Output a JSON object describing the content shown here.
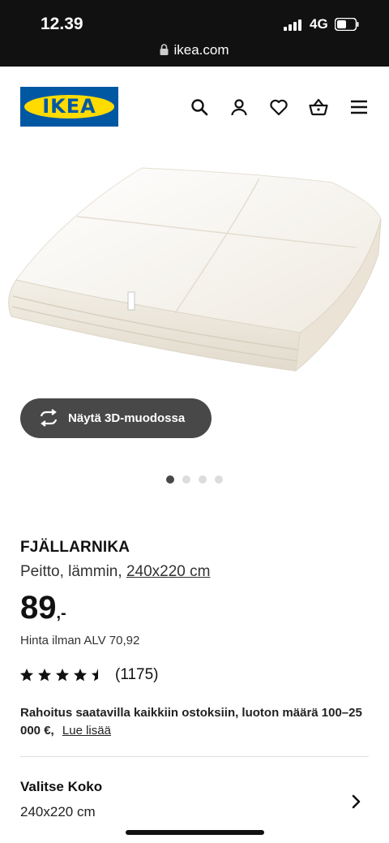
{
  "status_bar": {
    "time": "12.39",
    "network": "4G",
    "url": "ikea.com"
  },
  "header": {
    "logo_text": "IKEA",
    "icons": [
      "search-icon",
      "account-icon",
      "heart-icon",
      "basket-icon",
      "menu-icon"
    ]
  },
  "colors": {
    "brand_blue": "#0058a3",
    "brand_yellow": "#ffdb00",
    "button_dark": "#484848"
  },
  "gallery": {
    "button_3d_label": "Näytä 3D-muodossa"
  },
  "product": {
    "name": "FJÄLLARNIKA",
    "description": "Peitto, lämmin,",
    "size_link": "240x220 cm",
    "price": "89",
    "price_suffix": ",-",
    "vat_text": "Hinta ilman ALV 70,92",
    "rating_value": 4.5,
    "rating_max": 5,
    "rating_count": "(1175)",
    "finance_text": "Rahoitus saatavilla kaikkiin ostoksiin, luoton määrä 100–25 000 €,",
    "finance_link": "Lue lisää"
  },
  "size_selector": {
    "title": "Valitse Koko",
    "value": "240x220 cm"
  }
}
